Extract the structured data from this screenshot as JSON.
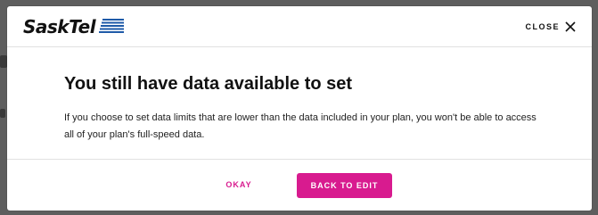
{
  "colors": {
    "accent": "#d81b8f",
    "logo_blue": "#1e5aa8",
    "overlay": "#5e5e5e"
  },
  "header": {
    "logo_text": "SaskTel",
    "close_label": "CLOSE",
    "close_icon": "close-icon"
  },
  "dialog": {
    "title": "You still have data available to set",
    "message": "If you choose to set data limits that are lower than the data included in your plan, you won't be able to access all of your plan's full-speed data."
  },
  "actions": {
    "okay_label": "OKAY",
    "back_label": "BACK TO EDIT"
  }
}
